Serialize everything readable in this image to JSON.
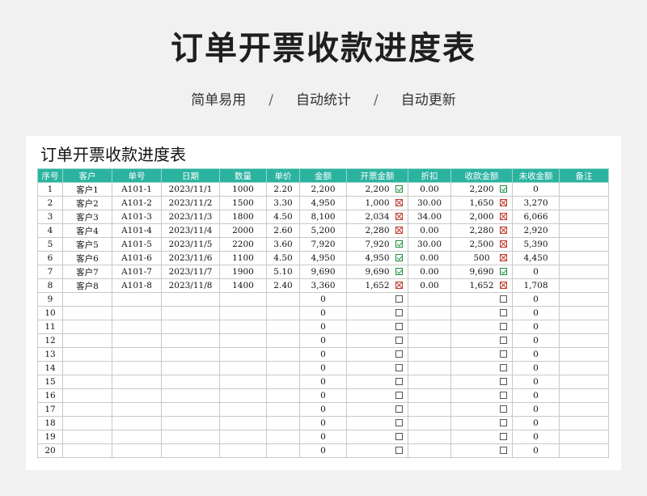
{
  "hero": {
    "title": "订单开票收款进度表",
    "tags": [
      "简单易用",
      "自动统计",
      "自动更新"
    ],
    "separator": "/"
  },
  "sheet": {
    "title": "订单开票收款进度表",
    "headers": [
      "序号",
      "客户",
      "单号",
      "日期",
      "数量",
      "单价",
      "金额",
      "开票金额",
      "折扣",
      "收款金额",
      "未收金额",
      "备注"
    ],
    "rows": [
      {
        "no": "1",
        "customer": "客户1",
        "order": "A101-1",
        "date": "2023/11/1",
        "qty": "1000",
        "price": "2.20",
        "amount": "2,200",
        "invoice": "2,200",
        "invoice_mark": "checked",
        "discount": "0.00",
        "received": "2,200",
        "received_mark": "checked",
        "unpaid": "0",
        "note": ""
      },
      {
        "no": "2",
        "customer": "客户2",
        "order": "A101-2",
        "date": "2023/11/2",
        "qty": "1500",
        "price": "3.30",
        "amount": "4,950",
        "invoice": "1,000",
        "invoice_mark": "crossed",
        "discount": "30.00",
        "received": "1,650",
        "received_mark": "crossed",
        "unpaid": "3,270",
        "note": ""
      },
      {
        "no": "3",
        "customer": "客户3",
        "order": "A101-3",
        "date": "2023/11/3",
        "qty": "1800",
        "price": "4.50",
        "amount": "8,100",
        "invoice": "2,034",
        "invoice_mark": "crossed",
        "discount": "34.00",
        "received": "2,000",
        "received_mark": "crossed",
        "unpaid": "6,066",
        "note": ""
      },
      {
        "no": "4",
        "customer": "客户4",
        "order": "A101-4",
        "date": "2023/11/4",
        "qty": "2000",
        "price": "2.60",
        "amount": "5,200",
        "invoice": "2,280",
        "invoice_mark": "crossed",
        "discount": "0.00",
        "received": "2,280",
        "received_mark": "crossed",
        "unpaid": "2,920",
        "note": ""
      },
      {
        "no": "5",
        "customer": "客户5",
        "order": "A101-5",
        "date": "2023/11/5",
        "qty": "2200",
        "price": "3.60",
        "amount": "7,920",
        "invoice": "7,920",
        "invoice_mark": "checked",
        "discount": "30.00",
        "received": "2,500",
        "received_mark": "crossed",
        "unpaid": "5,390",
        "note": ""
      },
      {
        "no": "6",
        "customer": "客户6",
        "order": "A101-6",
        "date": "2023/11/6",
        "qty": "1100",
        "price": "4.50",
        "amount": "4,950",
        "invoice": "4,950",
        "invoice_mark": "checked",
        "discount": "0.00",
        "received": "500",
        "received_mark": "crossed",
        "unpaid": "4,450",
        "note": ""
      },
      {
        "no": "7",
        "customer": "客户7",
        "order": "A101-7",
        "date": "2023/11/7",
        "qty": "1900",
        "price": "5.10",
        "amount": "9,690",
        "invoice": "9,690",
        "invoice_mark": "checked",
        "discount": "0.00",
        "received": "9,690",
        "received_mark": "checked",
        "unpaid": "0",
        "note": ""
      },
      {
        "no": "8",
        "customer": "客户8",
        "order": "A101-8",
        "date": "2023/11/8",
        "qty": "1400",
        "price": "2.40",
        "amount": "3,360",
        "invoice": "1,652",
        "invoice_mark": "crossed",
        "discount": "0.00",
        "received": "1,652",
        "received_mark": "crossed",
        "unpaid": "1,708",
        "note": ""
      },
      {
        "no": "9",
        "customer": "",
        "order": "",
        "date": "",
        "qty": "",
        "price": "",
        "amount": "0",
        "invoice": "",
        "invoice_mark": "empty",
        "discount": "",
        "received": "",
        "received_mark": "empty",
        "unpaid": "0",
        "note": ""
      },
      {
        "no": "10",
        "customer": "",
        "order": "",
        "date": "",
        "qty": "",
        "price": "",
        "amount": "0",
        "invoice": "",
        "invoice_mark": "empty",
        "discount": "",
        "received": "",
        "received_mark": "empty",
        "unpaid": "0",
        "note": ""
      },
      {
        "no": "11",
        "customer": "",
        "order": "",
        "date": "",
        "qty": "",
        "price": "",
        "amount": "0",
        "invoice": "",
        "invoice_mark": "empty",
        "discount": "",
        "received": "",
        "received_mark": "empty",
        "unpaid": "0",
        "note": ""
      },
      {
        "no": "12",
        "customer": "",
        "order": "",
        "date": "",
        "qty": "",
        "price": "",
        "amount": "0",
        "invoice": "",
        "invoice_mark": "empty",
        "discount": "",
        "received": "",
        "received_mark": "empty",
        "unpaid": "0",
        "note": ""
      },
      {
        "no": "13",
        "customer": "",
        "order": "",
        "date": "",
        "qty": "",
        "price": "",
        "amount": "0",
        "invoice": "",
        "invoice_mark": "empty",
        "discount": "",
        "received": "",
        "received_mark": "empty",
        "unpaid": "0",
        "note": ""
      },
      {
        "no": "14",
        "customer": "",
        "order": "",
        "date": "",
        "qty": "",
        "price": "",
        "amount": "0",
        "invoice": "",
        "invoice_mark": "empty",
        "discount": "",
        "received": "",
        "received_mark": "empty",
        "unpaid": "0",
        "note": ""
      },
      {
        "no": "15",
        "customer": "",
        "order": "",
        "date": "",
        "qty": "",
        "price": "",
        "amount": "0",
        "invoice": "",
        "invoice_mark": "empty",
        "discount": "",
        "received": "",
        "received_mark": "empty",
        "unpaid": "0",
        "note": ""
      },
      {
        "no": "16",
        "customer": "",
        "order": "",
        "date": "",
        "qty": "",
        "price": "",
        "amount": "0",
        "invoice": "",
        "invoice_mark": "empty",
        "discount": "",
        "received": "",
        "received_mark": "empty",
        "unpaid": "0",
        "note": ""
      },
      {
        "no": "17",
        "customer": "",
        "order": "",
        "date": "",
        "qty": "",
        "price": "",
        "amount": "0",
        "invoice": "",
        "invoice_mark": "empty",
        "discount": "",
        "received": "",
        "received_mark": "empty",
        "unpaid": "0",
        "note": ""
      },
      {
        "no": "18",
        "customer": "",
        "order": "",
        "date": "",
        "qty": "",
        "price": "",
        "amount": "0",
        "invoice": "",
        "invoice_mark": "empty",
        "discount": "",
        "received": "",
        "received_mark": "empty",
        "unpaid": "0",
        "note": ""
      },
      {
        "no": "19",
        "customer": "",
        "order": "",
        "date": "",
        "qty": "",
        "price": "",
        "amount": "0",
        "invoice": "",
        "invoice_mark": "empty",
        "discount": "",
        "received": "",
        "received_mark": "empty",
        "unpaid": "0",
        "note": ""
      },
      {
        "no": "20",
        "customer": "",
        "order": "",
        "date": "",
        "qty": "",
        "price": "",
        "amount": "0",
        "invoice": "",
        "invoice_mark": "empty",
        "discount": "",
        "received": "",
        "received_mark": "empty",
        "unpaid": "0",
        "note": ""
      }
    ]
  },
  "colors": {
    "header_bg": "#2bb3a0",
    "check_green": "#1f9a3f",
    "cross_red": "#c0392b"
  },
  "icons": {
    "checked": "checkbox-checked-icon",
    "crossed": "checkbox-crossed-icon",
    "empty": "checkbox-empty-icon"
  }
}
